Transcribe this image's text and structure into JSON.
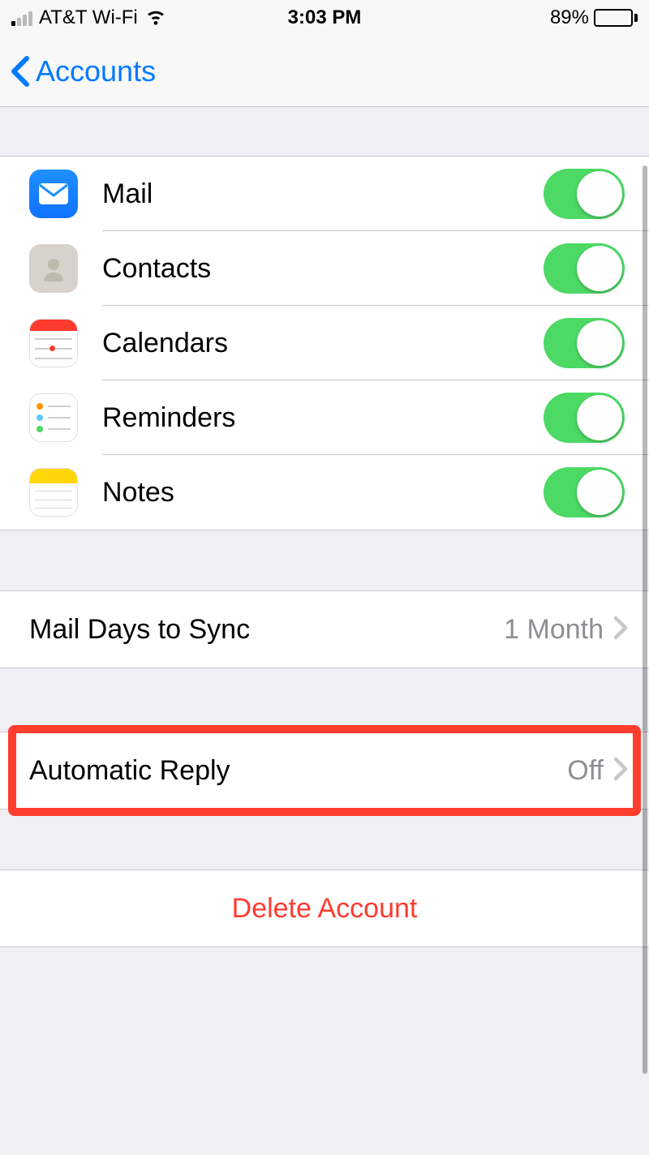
{
  "status": {
    "carrier": "AT&T Wi-Fi",
    "time": "3:03 PM",
    "battery_pct": "89%"
  },
  "nav": {
    "back_label": "Accounts"
  },
  "services": [
    {
      "label": "Mail",
      "icon": "mail-icon",
      "on": true
    },
    {
      "label": "Contacts",
      "icon": "contacts-icon",
      "on": true
    },
    {
      "label": "Calendars",
      "icon": "calendars-icon",
      "on": true
    },
    {
      "label": "Reminders",
      "icon": "reminders-icon",
      "on": true
    },
    {
      "label": "Notes",
      "icon": "notes-icon",
      "on": true
    }
  ],
  "mail_sync": {
    "label": "Mail Days to Sync",
    "value": "1 Month"
  },
  "auto_reply": {
    "label": "Automatic Reply",
    "value": "Off"
  },
  "delete": {
    "label": "Delete Account"
  },
  "colors": {
    "accent": "#007aff",
    "toggle_on": "#4cd964",
    "destructive": "#ff3b30",
    "highlight": "#ff3d2e"
  }
}
